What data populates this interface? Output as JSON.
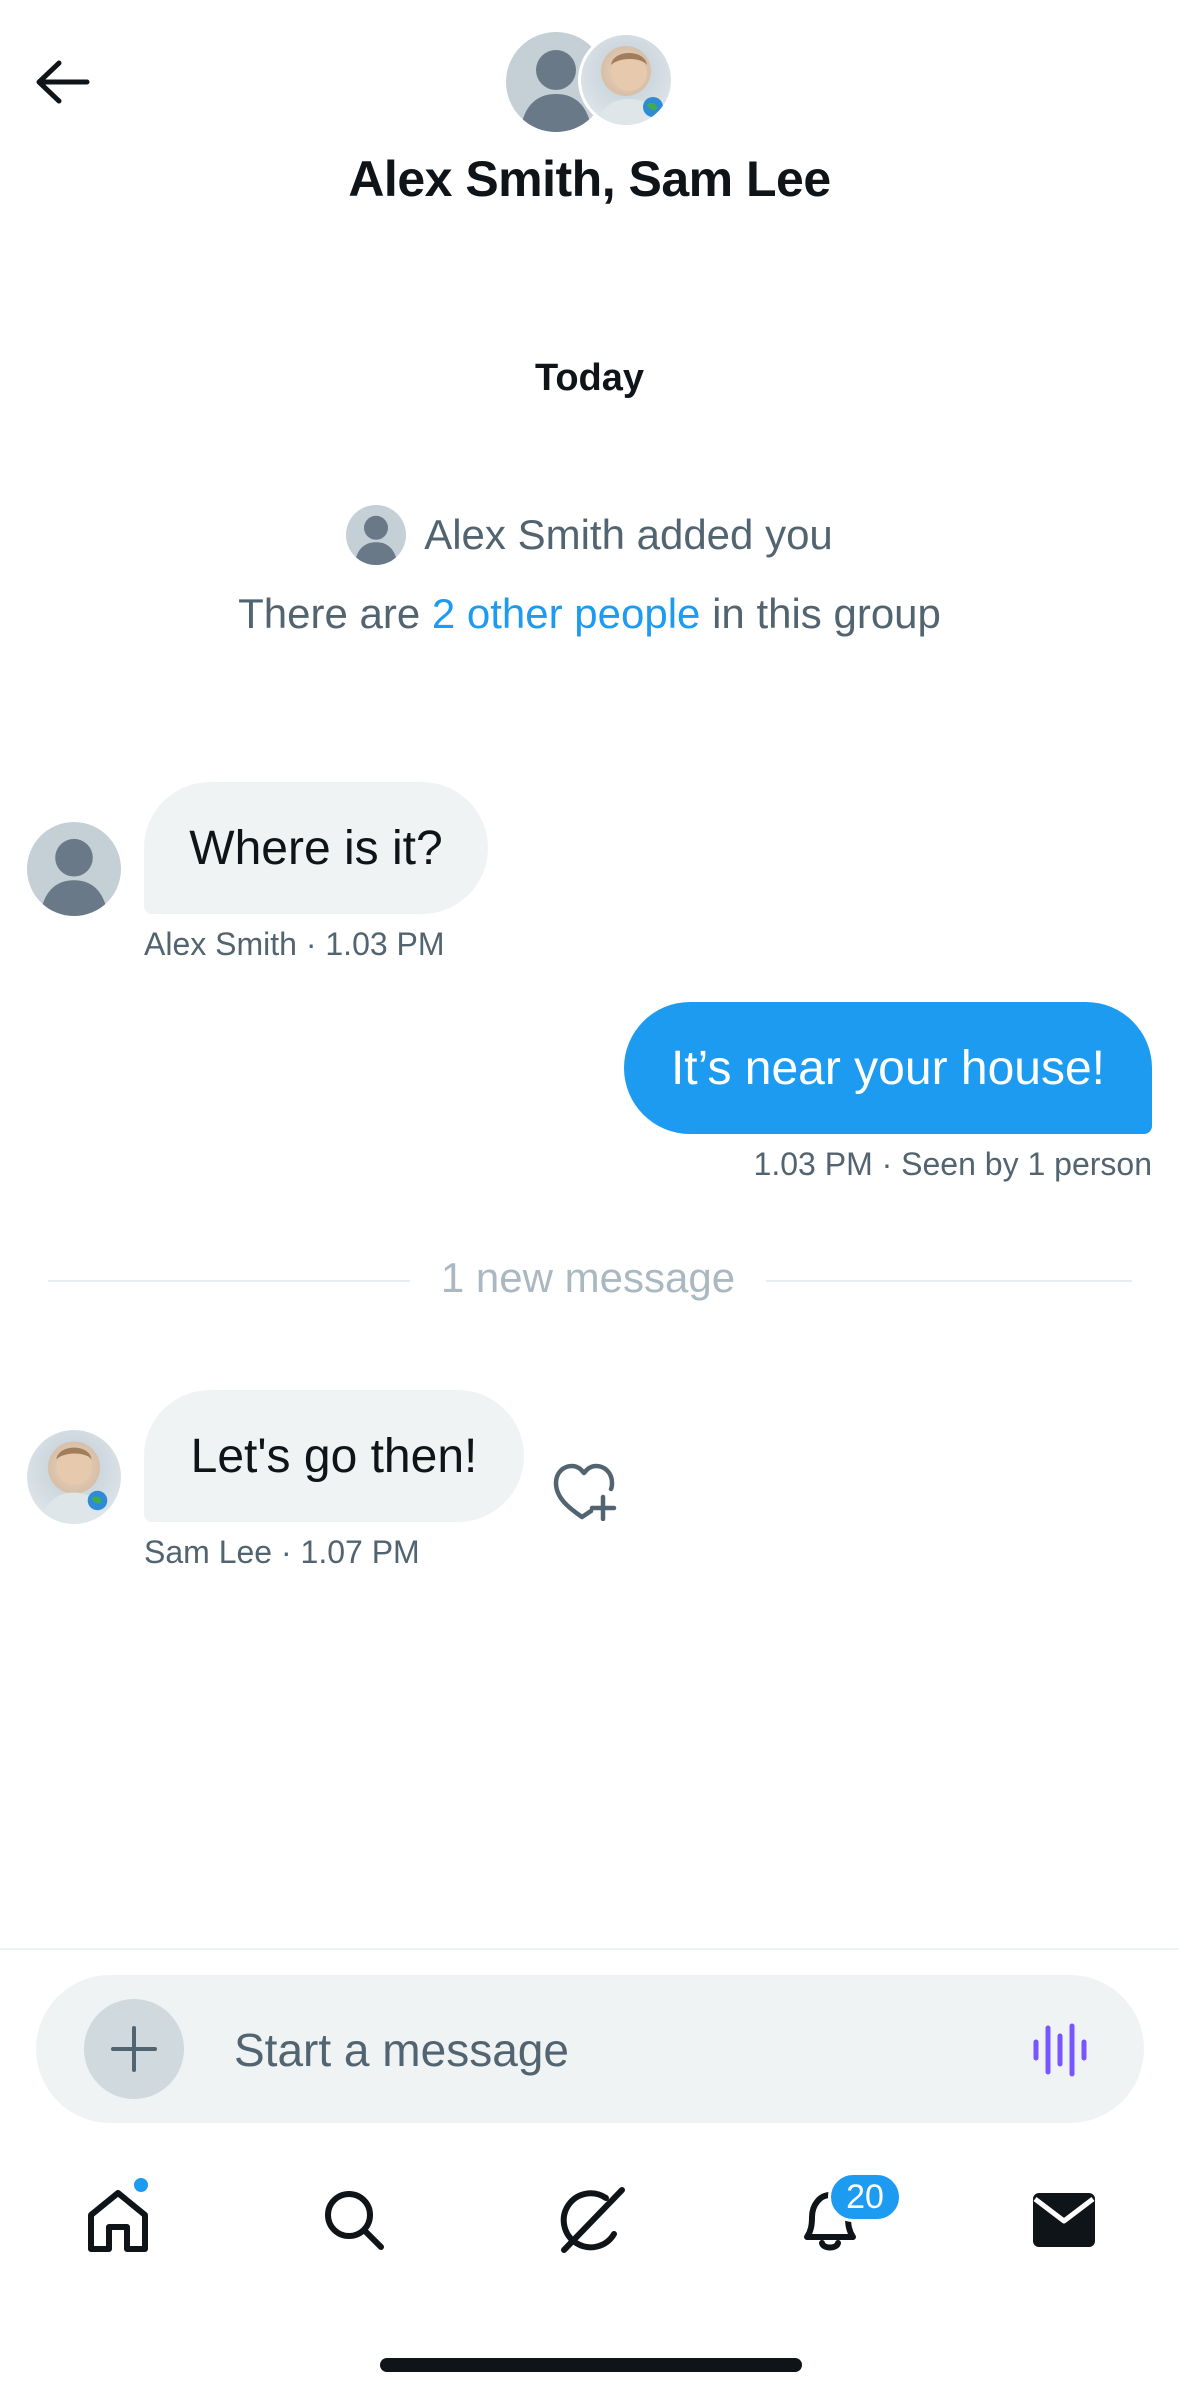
{
  "header": {
    "title": "Alex Smith, Sam Lee"
  },
  "conversation": {
    "day_label": "Today",
    "system_added": "Alex Smith added you",
    "group_prefix": "There are ",
    "group_link": "2 other people",
    "group_suffix": " in this group",
    "new_messages_label": "1 new message",
    "messages": [
      {
        "text": "Where is it?",
        "meta": "Alex Smith · 1.03 PM"
      },
      {
        "text": "It’s near your house!",
        "meta": "1.03 PM · Seen by 1 person"
      },
      {
        "text": "Let's go then!",
        "meta": "Sam Lee · 1.07 PM"
      }
    ]
  },
  "composer": {
    "placeholder": "Start a message"
  },
  "tabbar": {
    "notifications_count": "20"
  },
  "colors": {
    "accent": "#1d9bf0",
    "bubble_in": "#eff3f4",
    "voice_icon": "#7856ff"
  },
  "icons": [
    "back-arrow-icon",
    "plus-icon",
    "voice-wave-icon",
    "home-icon",
    "search-icon",
    "grok-icon",
    "bell-icon",
    "mail-icon",
    "heart-plus-icon"
  ]
}
